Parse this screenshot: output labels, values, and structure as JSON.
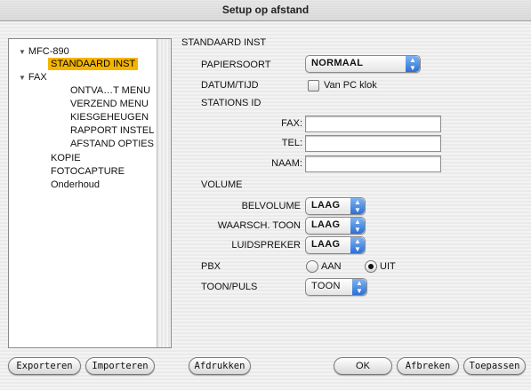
{
  "window": {
    "title": "Setup op afstand"
  },
  "tree": {
    "items": [
      {
        "label": "MFC-890",
        "expanded": true,
        "level": 0,
        "selected": false
      },
      {
        "label": "STANDAARD INST",
        "level": 1,
        "selected": true
      },
      {
        "label": "FAX",
        "expanded": true,
        "level": 0,
        "selected": false
      },
      {
        "label": "ONTVA…T MENU",
        "level": 2,
        "selected": false
      },
      {
        "label": "VERZEND MENU",
        "level": 2,
        "selected": false
      },
      {
        "label": "KIESGEHEUGEN",
        "level": 2,
        "selected": false
      },
      {
        "label": "RAPPORT INSTEL",
        "level": 2,
        "selected": false
      },
      {
        "label": "AFSTAND OPTIES",
        "level": 2,
        "selected": false
      },
      {
        "label": "KOPIE",
        "level": 0,
        "selected": false
      },
      {
        "label": "FOTOCAPTURE",
        "level": 0,
        "selected": false
      },
      {
        "label": "Onderhoud",
        "level": 0,
        "selected": false
      }
    ]
  },
  "form": {
    "section_title": "STANDAARD INST",
    "papiersoort": {
      "label": "PAPIERSOORT",
      "value": "NORMAAL"
    },
    "datum": {
      "label": "DATUM/TIJD",
      "checkbox_label": "Van PC klok",
      "checked": false
    },
    "stations": {
      "label": "STATIONS ID",
      "fax_label": "FAX:",
      "fax_value": "",
      "tel_label": "TEL:",
      "tel_value": "",
      "naam_label": "NAAM:",
      "naam_value": ""
    },
    "volume": {
      "label": "VOLUME",
      "belvolume": {
        "label": "BELVOLUME",
        "value": "LAAG"
      },
      "waarsch": {
        "label": "WAARSCH. TOON",
        "value": "LAAG"
      },
      "luidspreker": {
        "label": "LUIDSPREKER",
        "value": "LAAG"
      }
    },
    "pbx": {
      "label": "PBX",
      "option_on": "AAN",
      "option_off": "UIT",
      "selected": "UIT"
    },
    "toon": {
      "label": "TOON/PULS",
      "value": "TOON"
    }
  },
  "buttons": {
    "exporteren": "Exporteren",
    "importeren": "Importeren",
    "afdrukken": "Afdrukken",
    "ok": "OK",
    "afbreken": "Afbreken",
    "toepassen": "Toepassen"
  },
  "colors": {
    "selection": "#f4b400",
    "popup_arrow": "#2c6fd6"
  }
}
